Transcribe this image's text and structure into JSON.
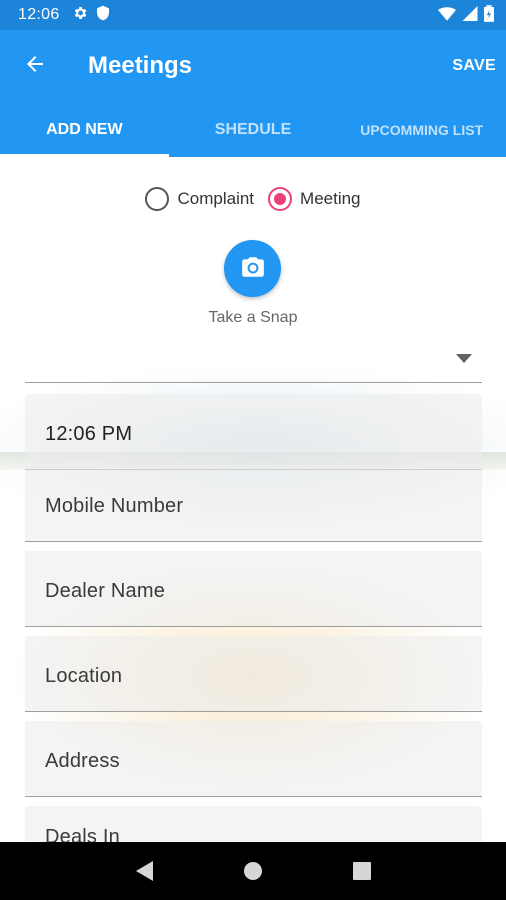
{
  "status_bar": {
    "time": "12:06",
    "icons": [
      "settings-gear-icon",
      "shield-icon",
      "wifi-icon",
      "signal-icon",
      "battery-icon"
    ]
  },
  "app_bar": {
    "back_icon": "arrow-back-icon",
    "title": "Meetings",
    "save_label": "SAVE"
  },
  "tabs": [
    {
      "label": "ADD NEW",
      "active": true
    },
    {
      "label": "SHEDULE",
      "active": false
    },
    {
      "label": "UPCOMMING LIST",
      "active": false
    }
  ],
  "form": {
    "type_options": [
      {
        "label": "Complaint",
        "checked": false
      },
      {
        "label": "Meeting",
        "checked": true
      }
    ],
    "camera_icon": "camera-icon",
    "snap_label": "Take a Snap",
    "dropdown_value": "",
    "time_value": "12:06 PM",
    "mobile_placeholder": "Mobile Number",
    "dealer_placeholder": "Dealer Name",
    "location_placeholder": "Location",
    "address_placeholder": "Address",
    "deals_in_placeholder": "Deals In"
  },
  "colors": {
    "status_bar": "#1c85d9",
    "primary": "#2196f3",
    "radio_accent": "#ec407a",
    "nav_bar": "#000000"
  }
}
